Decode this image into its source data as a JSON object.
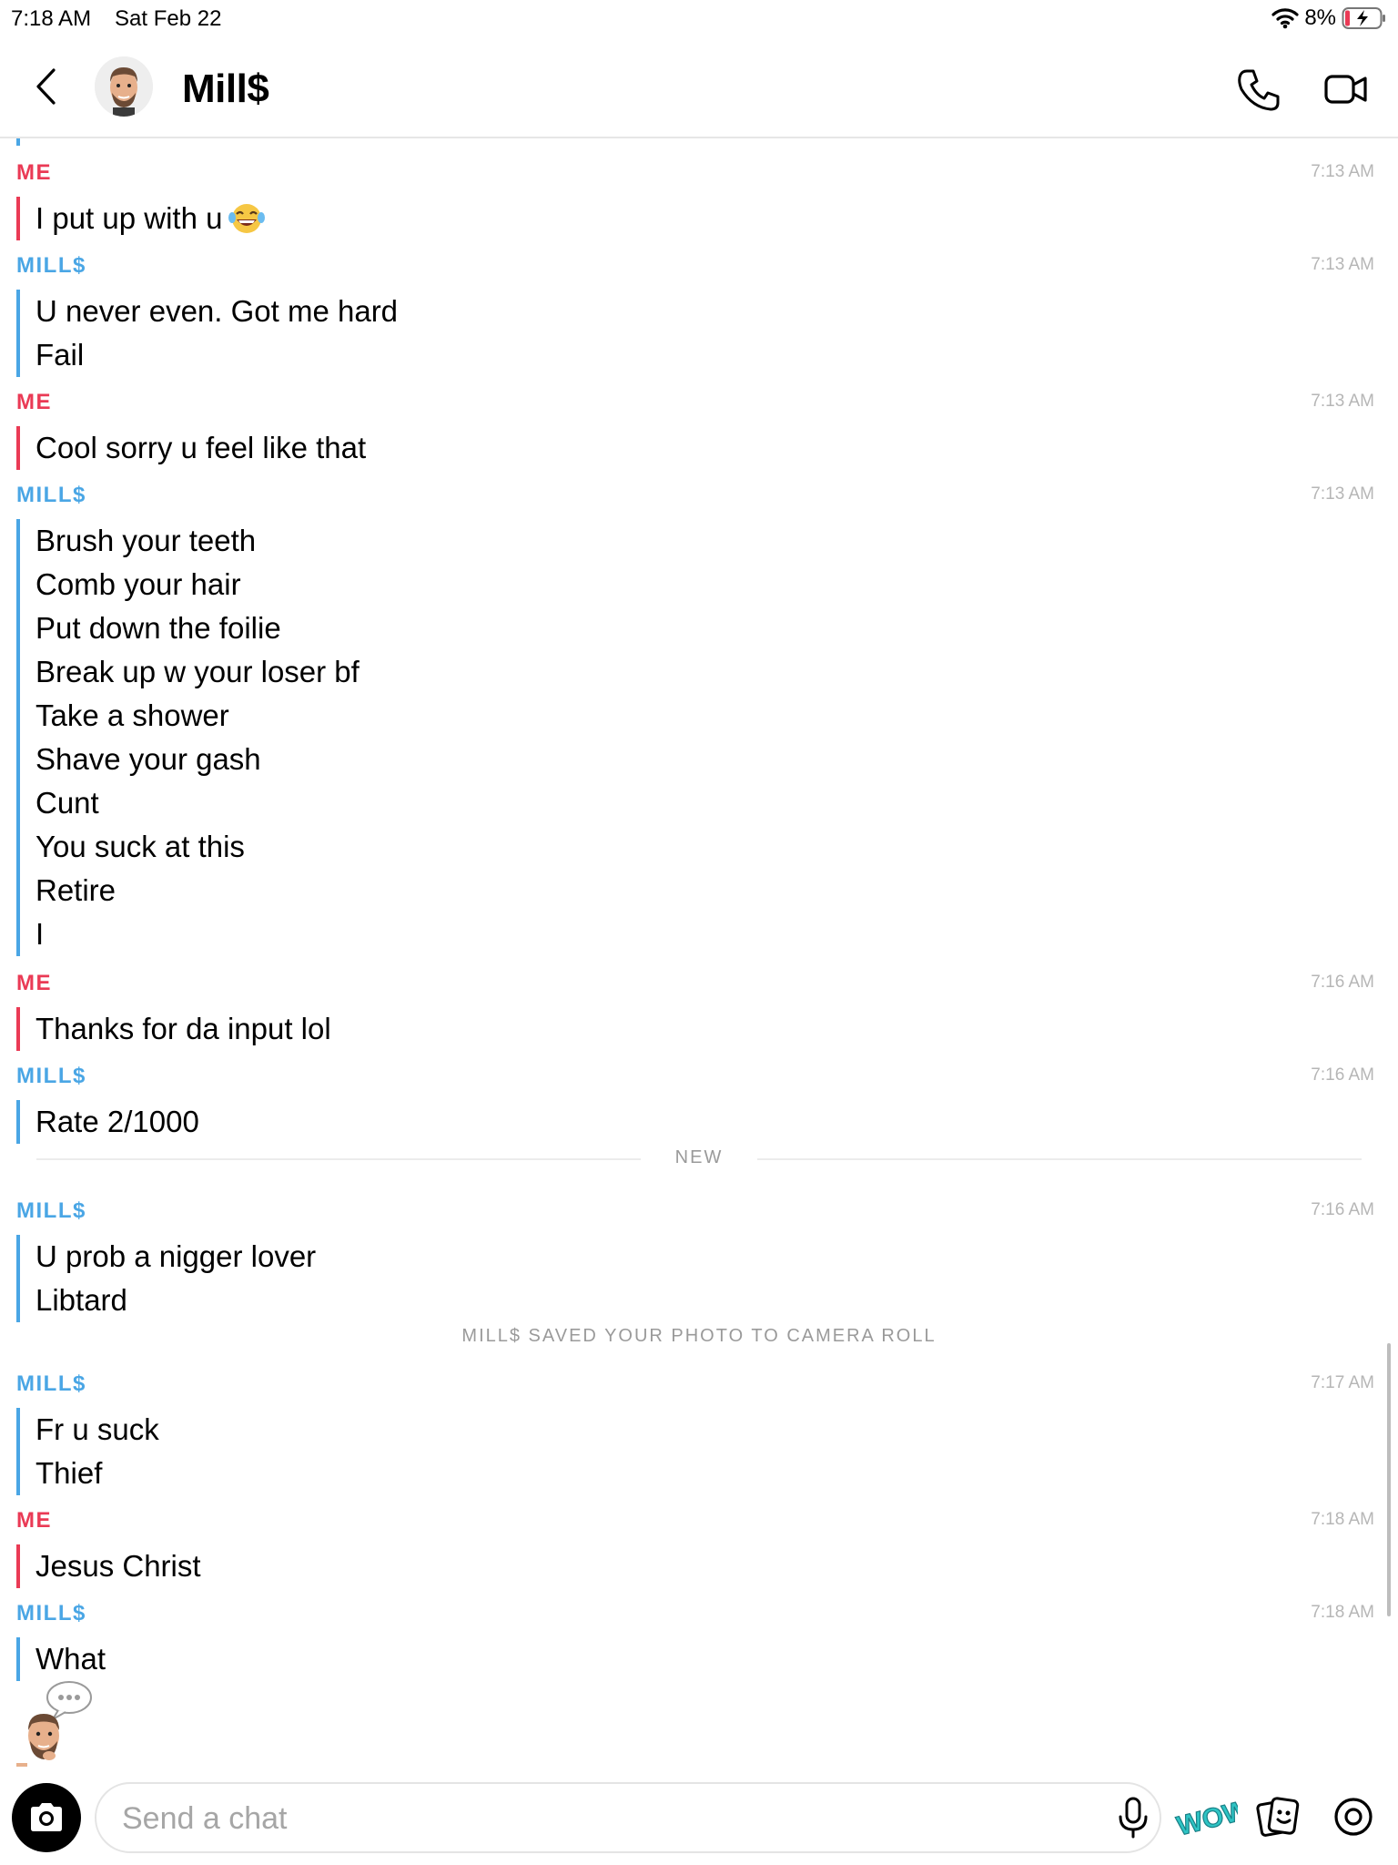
{
  "status_bar": {
    "time": "7:18 AM",
    "date": "Sat Feb 22",
    "battery": "8%",
    "icons": [
      "wifi-icon",
      "battery-charging-icon"
    ]
  },
  "header": {
    "title": "Mill$",
    "icons": [
      "chevron-left-icon",
      "bitmoji-avatar",
      "phone-icon",
      "video-camera-icon"
    ]
  },
  "messages": [
    {
      "sender": "ME",
      "time": "7:13 AM",
      "lines": [
        "I put up with u"
      ],
      "emoji": "laughing-tears-emoji"
    },
    {
      "sender": "MILL$",
      "time": "7:13 AM",
      "lines": [
        "U never even. Got me hard",
        "Fail"
      ]
    },
    {
      "sender": "ME",
      "time": "7:13 AM",
      "lines": [
        "Cool sorry u feel like that"
      ]
    },
    {
      "sender": "MILL$",
      "time": "7:13 AM",
      "lines": [
        "Brush your teeth",
        "Comb your hair",
        "Put down the foilie",
        "Break up w your loser bf",
        "Take a shower",
        "Shave your gash",
        "Cunt",
        "You suck at this",
        "Retire",
        "I"
      ]
    },
    {
      "sender": "ME",
      "time": "7:16 AM",
      "lines": [
        "Thanks for da input lol"
      ]
    },
    {
      "sender": "MILL$",
      "time": "7:16 AM",
      "lines": [
        "Rate 2/1000"
      ]
    },
    {
      "sender": "MILL$",
      "time": "7:16 AM",
      "lines": [
        "U prob a nigger lover",
        "Libtard"
      ]
    },
    {
      "sender": "MILL$",
      "time": "7:17 AM",
      "lines": [
        "Fr u suck",
        "Thief"
      ]
    },
    {
      "sender": "ME",
      "time": "7:18 AM",
      "lines": [
        "Jesus Christ"
      ]
    },
    {
      "sender": "MILL$",
      "time": "7:18 AM",
      "lines": [
        "What"
      ]
    }
  ],
  "divider": {
    "label": "NEW"
  },
  "system_note": "MILL$ SAVED YOUR PHOTO TO CAMERA ROLL",
  "composer": {
    "placeholder": "Send a chat",
    "sticker_label": "WOW"
  },
  "colors": {
    "me": "#ea3a55",
    "them": "#4aa6e5",
    "timestamp": "#b6b6b6",
    "system_text": "#9a9a9a"
  }
}
